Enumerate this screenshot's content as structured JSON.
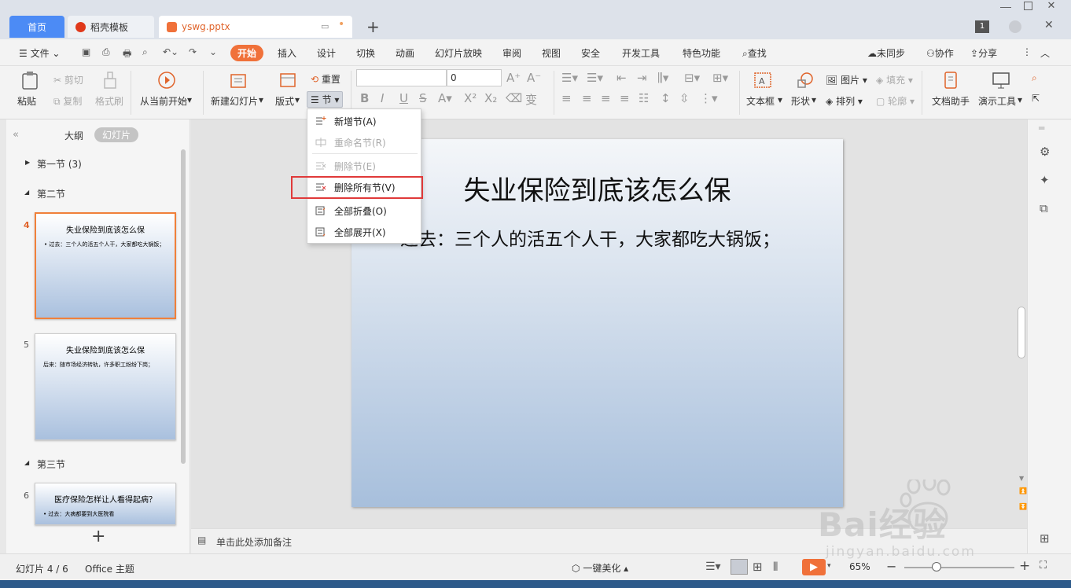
{
  "tabs": {
    "home": "首页",
    "template": "稻壳模板",
    "file": "yswg.pptx"
  },
  "window": {
    "badge": "1"
  },
  "menu": {
    "file": "文件",
    "items": [
      "开始",
      "插入",
      "设计",
      "切换",
      "动画",
      "幻灯片放映",
      "审阅",
      "视图",
      "安全",
      "开发工具",
      "特色功能"
    ],
    "search": "查找",
    "sync": "未同步",
    "collab": "协作",
    "share": "分享"
  },
  "ribbon": {
    "paste": "粘贴",
    "cut": "剪切",
    "copy": "复制",
    "format_painter": "格式刷",
    "from_current": "从当前开始",
    "new_slide": "新建幻灯片",
    "layout": "版式",
    "reset": "重置",
    "section": "节",
    "font_size": "0",
    "textbox": "文本框",
    "shape": "形状",
    "picture": "图片",
    "fill": "填充",
    "arrange": "排列",
    "outline": "轮廓",
    "doc_helper": "文档助手",
    "present_tool": "演示工具"
  },
  "panel": {
    "tab_outline": "大纲",
    "tab_slides": "幻灯片",
    "sections": [
      "第一节 (3)",
      "第二节",
      "第三节"
    ],
    "thumbs": [
      {
        "num": "4",
        "title": "失业保险到底该怎么保",
        "body": "• 过去：三个人的活五个人干，大家都吃大锅饭；"
      },
      {
        "num": "5",
        "title": "失业保险到底该怎么保",
        "body": "后来：随市场经济转轨，许多职工纷纷下岗；"
      },
      {
        "num": "6",
        "title": "医疗保险怎样让人看得起病？",
        "body": "• 过去：大病都要到大医院看"
      }
    ]
  },
  "slide": {
    "title": "失业保险到底该怎么保",
    "body": "过去：三个人的活五个人干，大家都吃大锅饭；"
  },
  "notes": {
    "placeholder": "单击此处添加备注"
  },
  "dropdown": {
    "items": [
      {
        "label": "新增节(A)",
        "enabled": true
      },
      {
        "label": "重命名节(R)",
        "enabled": false
      },
      {
        "label": "删除节(E)",
        "enabled": false
      },
      {
        "label": "删除所有节(V)",
        "enabled": true
      },
      {
        "label": "全部折叠(O)",
        "enabled": true
      },
      {
        "label": "全部展开(X)",
        "enabled": true
      }
    ]
  },
  "status": {
    "slide_count": "幻灯片 4 / 6",
    "theme": "Office 主题",
    "beautify": "一键美化",
    "zoom": "65%"
  },
  "watermark": {
    "brand": "Bai经验",
    "url": "jingyan.baidu.com"
  },
  "colors": {
    "accent": "#f0713a",
    "tab_blue": "#4c8bf5",
    "highlight": "#e03a3a"
  }
}
